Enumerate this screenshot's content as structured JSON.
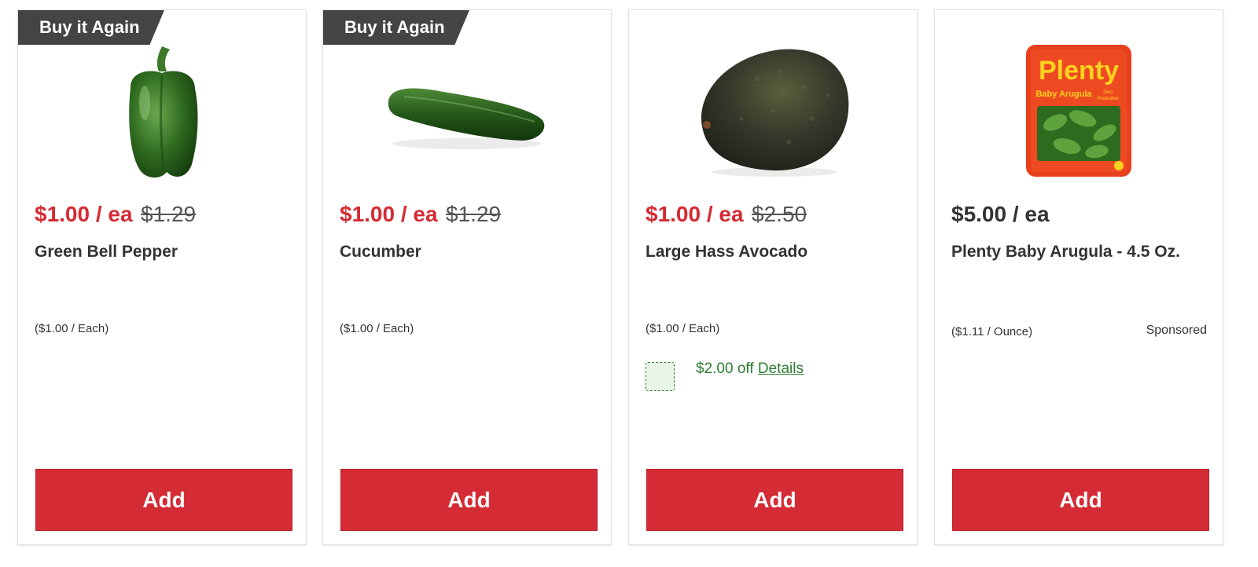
{
  "products": [
    {
      "badge": "Buy it Again",
      "sale_price": "$1.00 / ea",
      "was_price": "$1.29",
      "name": "Green Bell Pepper",
      "unit_price": "($1.00 / Each)",
      "add_label": "Add",
      "image_icon": "green-bell-pepper-image"
    },
    {
      "badge": "Buy it Again",
      "sale_price": "$1.00 / ea",
      "was_price": "$1.29",
      "name": "Cucumber",
      "unit_price": "($1.00 / Each)",
      "add_label": "Add",
      "image_icon": "cucumber-image"
    },
    {
      "sale_price": "$1.00 / ea",
      "was_price": "$2.50",
      "name": "Large Hass Avocado",
      "unit_price": "($1.00 / Each)",
      "coupon": {
        "offer": "$2.00 off",
        "details_label": "Details"
      },
      "add_label": "Add",
      "image_icon": "avocado-image"
    },
    {
      "price": "$5.00 / ea",
      "name": "Plenty Baby Arugula - 4.5 Oz.",
      "unit_price": "($1.11 / Ounce)",
      "sponsored_label": "Sponsored",
      "add_label": "Add",
      "image_icon": "plenty-arugula-package-image",
      "package_text": {
        "brand": "Plenty",
        "product": "Baby Arugula",
        "claim_line1": "Zero",
        "claim_line2": "Pesticides"
      }
    }
  ],
  "colors": {
    "sale_red": "#d52b34",
    "badge_gray": "#444444",
    "coupon_green": "#2e7d32",
    "text_dark": "#333333"
  }
}
